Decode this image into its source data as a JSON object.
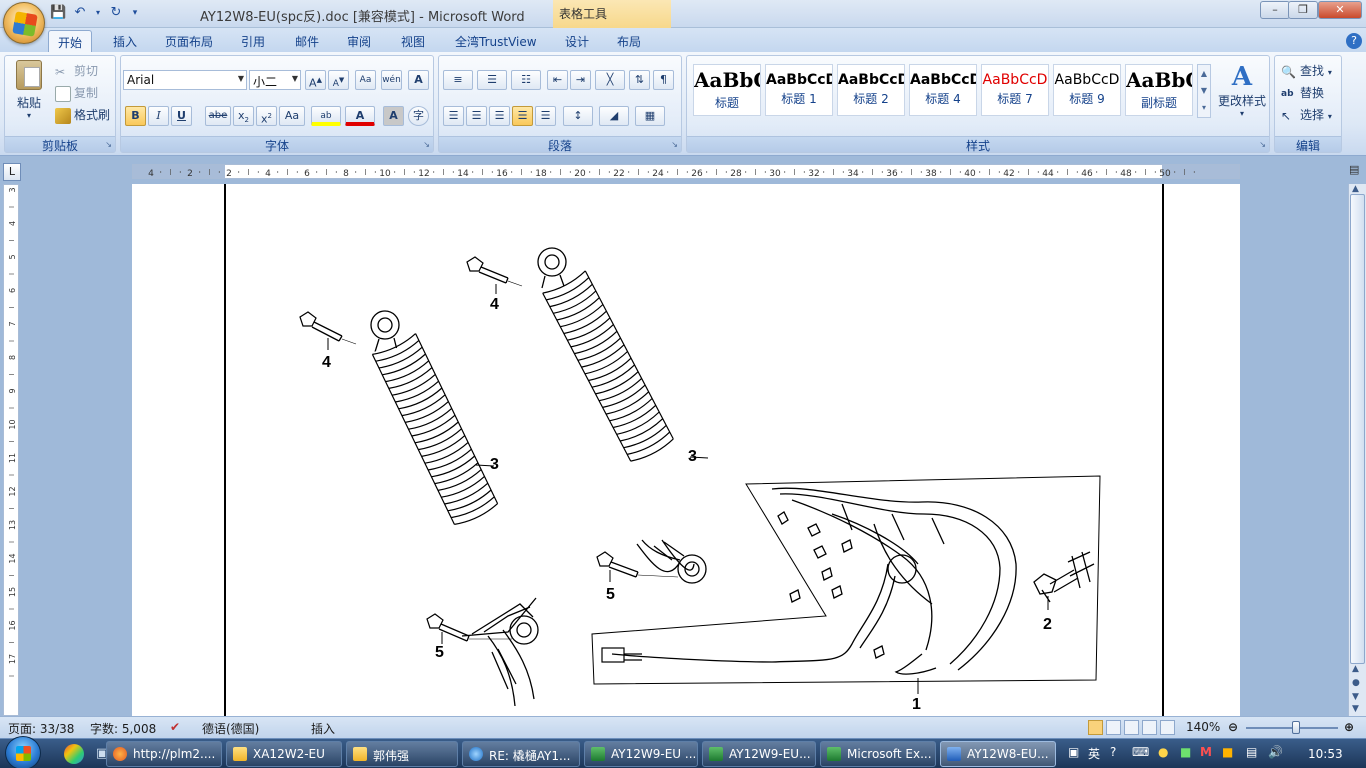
{
  "window": {
    "title": "AY12W8-EU(spc反).doc [兼容模式] - Microsoft Word",
    "context_tool": "表格工具"
  },
  "tabs": [
    "开始",
    "插入",
    "页面布局",
    "引用",
    "邮件",
    "审阅",
    "视图",
    "全湾TrustView",
    "设计",
    "布局"
  ],
  "ribbon": {
    "clipboard": {
      "paste": "粘贴",
      "cut": "剪切",
      "copy": "复制",
      "format_painter": "格式刷",
      "label": "剪贴板"
    },
    "font": {
      "name": "Arial",
      "size": "小二",
      "label": "字体"
    },
    "paragraph": {
      "label": "段落"
    },
    "styles": {
      "label": "样式",
      "items": [
        {
          "sample": "AaBbC",
          "name": "标题"
        },
        {
          "sample": "AaBbCcD",
          "name": "标题 1"
        },
        {
          "sample": "AaBbCcD",
          "name": "标题 2"
        },
        {
          "sample": "AaBbCcD",
          "name": "标题 4"
        },
        {
          "sample": "AaBbCcD",
          "name": "标题 7"
        },
        {
          "sample": "AaBbCcD",
          "name": "标题 9"
        },
        {
          "sample": "AaBbC",
          "name": "副标题"
        }
      ],
      "change_styles": "更改样式"
    },
    "editing": {
      "find": "查找",
      "replace": "替换",
      "select": "选择",
      "label": "编辑"
    }
  },
  "ruler": {
    "h_ticks": [
      "4",
      "2",
      "2",
      "4",
      "6",
      "8",
      "10",
      "12",
      "14",
      "16",
      "18",
      "20",
      "22",
      "24",
      "26",
      "28",
      "30",
      "32",
      "34",
      "36",
      "38",
      "40",
      "42",
      "44",
      "46",
      "48",
      "50"
    ],
    "v_ticks": [
      "3",
      "4",
      "5",
      "6",
      "7",
      "8",
      "9",
      "10",
      "11",
      "12",
      "13",
      "14",
      "15",
      "16",
      "17"
    ]
  },
  "diagram": {
    "callouts": [
      "4",
      "4",
      "3",
      "3",
      "5",
      "5",
      "2",
      "1"
    ]
  },
  "status": {
    "page": "页面: 33/38",
    "words": "字数: 5,008",
    "language": "德语(德国)",
    "mode": "插入",
    "zoom": "140%"
  },
  "taskbar": {
    "items": [
      "http://plm2....",
      "XA12W2-EU",
      "郭伟强",
      "RE: 橇樋AY1...",
      "AY12W9-EU ...",
      "AY12W9-EU...",
      "Microsoft Ex...",
      "AY12W8-EU..."
    ],
    "ime": "英",
    "clock": "10:53"
  }
}
